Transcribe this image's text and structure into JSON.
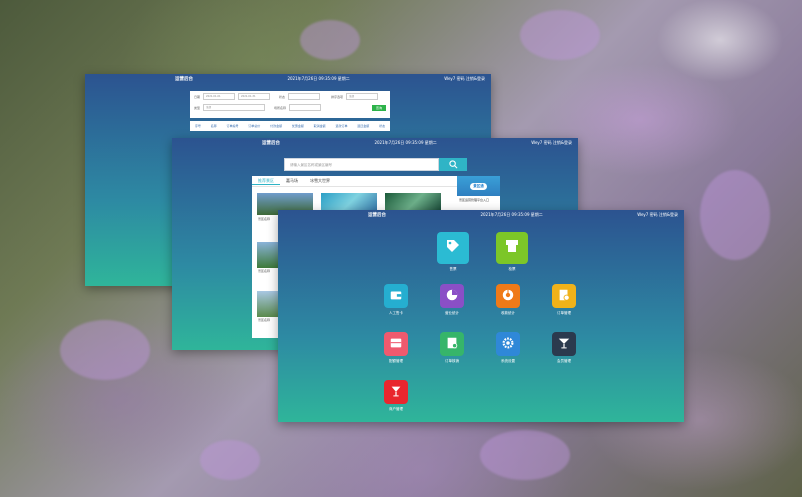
{
  "brand": "运营后台",
  "datetime": "2021年7月26日 09:35:09 星期二",
  "user_info": "Wey7  密码  注销&登录",
  "window1": {
    "form": {
      "row1": {
        "label_date": "日期",
        "date_from": "2021-01-01",
        "date_to": "2021-01-31",
        "label_status": "状态",
        "label_right": "排序选项",
        "select_value": "全部"
      },
      "row2": {
        "label_type": "类型",
        "type_value": "全部",
        "label_name": "场所名称",
        "query_label": "查询"
      }
    },
    "columns": [
      "序号",
      "名称",
      "订单编号",
      "订单总价",
      "付款金额",
      "优惠金额",
      "取消金额",
      "退款订单",
      "退还金额",
      "状态"
    ]
  },
  "window2": {
    "search_placeholder": "请输入景区名称或景区编号",
    "tabs": [
      "推荐景区",
      "嘉马场",
      "冰雪大世界"
    ],
    "sidebar": {
      "logo": "景区通",
      "desc": "景区运营管理平台入口"
    },
    "thumb_captions": [
      "景区名称",
      "景区名称",
      "景区名称"
    ]
  },
  "window3": {
    "icons": [
      {
        "label": "售票",
        "name": "ticket-icon",
        "color": "#2bbbd3"
      },
      {
        "label": "检票",
        "name": "ticket-machine-icon",
        "color": "#7cc628"
      },
      {
        "label": "人工售卡",
        "name": "card-wallet-icon",
        "color": "#25aed0"
      },
      {
        "label": "营业统计",
        "name": "pie-chart-icon",
        "color": "#8a4fc6"
      },
      {
        "label": "收款统计",
        "name": "donut-chart-icon",
        "color": "#ef7a18"
      },
      {
        "label": "订单管理",
        "name": "order-settings-icon",
        "color": "#f0b21a"
      },
      {
        "label": "配额管理",
        "name": "quota-box-icon",
        "color": "#ef5a6e"
      },
      {
        "label": "订单核销",
        "name": "verify-document-icon",
        "color": "#36b56a"
      },
      {
        "label": "系统设置",
        "name": "gear-icon",
        "color": "#2f88d8"
      },
      {
        "label": "会员管理",
        "name": "cocktail-icon",
        "color": "#2b3a4e"
      },
      {
        "label": "商户管理",
        "name": "drink-icon",
        "color": "#e9262e"
      }
    ]
  }
}
